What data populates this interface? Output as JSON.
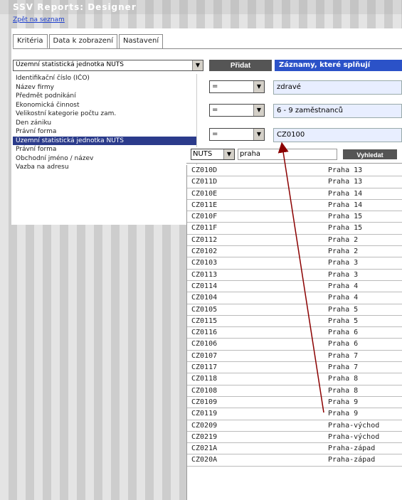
{
  "app": {
    "title": "SSV Reports: Designer",
    "back_link": "Zpět na seznam"
  },
  "tabs": [
    {
      "label": "Kritéria"
    },
    {
      "label": "Data k zobrazení"
    },
    {
      "label": "Nastavení"
    }
  ],
  "criteria_select": {
    "value": "Územní statistická jednotka NUTS"
  },
  "add_button": "Přidat",
  "records_label": "Záznamy, které splňují",
  "criteria_list": [
    "Identifikační číslo (IČO)",
    "Název firmy",
    "Předmět podnikání",
    "Ekonomická činnost",
    "Velikostní kategorie počtu zam.",
    "Den zániku",
    "Právní forma",
    "Územní statistická jednotka NUTS",
    "Právní forma",
    "Obchodní jméno / název",
    "Vazba na adresu"
  ],
  "selected_criterion_index": 7,
  "conditions": [
    {
      "operator": "=",
      "value": "zdravé"
    },
    {
      "operator": "=",
      "value": "6 - 9 zaměstnanců"
    },
    {
      "operator": "=",
      "value": "CZ0100"
    }
  ],
  "search": {
    "level": "NUTS",
    "query": "praha",
    "button": "Vyhledat"
  },
  "results": [
    {
      "code": "CZ010D",
      "name": "Praha 13"
    },
    {
      "code": "CZ011D",
      "name": "Praha 13"
    },
    {
      "code": "CZ010E",
      "name": "Praha 14"
    },
    {
      "code": "CZ011E",
      "name": "Praha 14"
    },
    {
      "code": "CZ010F",
      "name": "Praha 15"
    },
    {
      "code": "CZ011F",
      "name": "Praha 15"
    },
    {
      "code": "CZ0112",
      "name": "Praha 2"
    },
    {
      "code": "CZ0102",
      "name": "Praha 2"
    },
    {
      "code": "CZ0103",
      "name": "Praha 3"
    },
    {
      "code": "CZ0113",
      "name": "Praha 3"
    },
    {
      "code": "CZ0114",
      "name": "Praha 4"
    },
    {
      "code": "CZ0104",
      "name": "Praha 4"
    },
    {
      "code": "CZ0105",
      "name": "Praha 5"
    },
    {
      "code": "CZ0115",
      "name": "Praha 5"
    },
    {
      "code": "CZ0116",
      "name": "Praha 6"
    },
    {
      "code": "CZ0106",
      "name": "Praha 6"
    },
    {
      "code": "CZ0107",
      "name": "Praha 7"
    },
    {
      "code": "CZ0117",
      "name": "Praha 7"
    },
    {
      "code": "CZ0118",
      "name": "Praha 8"
    },
    {
      "code": "CZ0108",
      "name": "Praha 8"
    },
    {
      "code": "CZ0109",
      "name": "Praha 9"
    },
    {
      "code": "CZ0119",
      "name": "Praha 9"
    },
    {
      "code": "CZ0209",
      "name": "Praha-východ"
    },
    {
      "code": "CZ0219",
      "name": "Praha-východ"
    },
    {
      "code": "CZ021A",
      "name": "Praha-západ"
    },
    {
      "code": "CZ020A",
      "name": "Praha-západ"
    }
  ],
  "colors": {
    "accent": "#2b52c8",
    "selected": "#2b3b8b",
    "arrow": "#8b0000"
  }
}
